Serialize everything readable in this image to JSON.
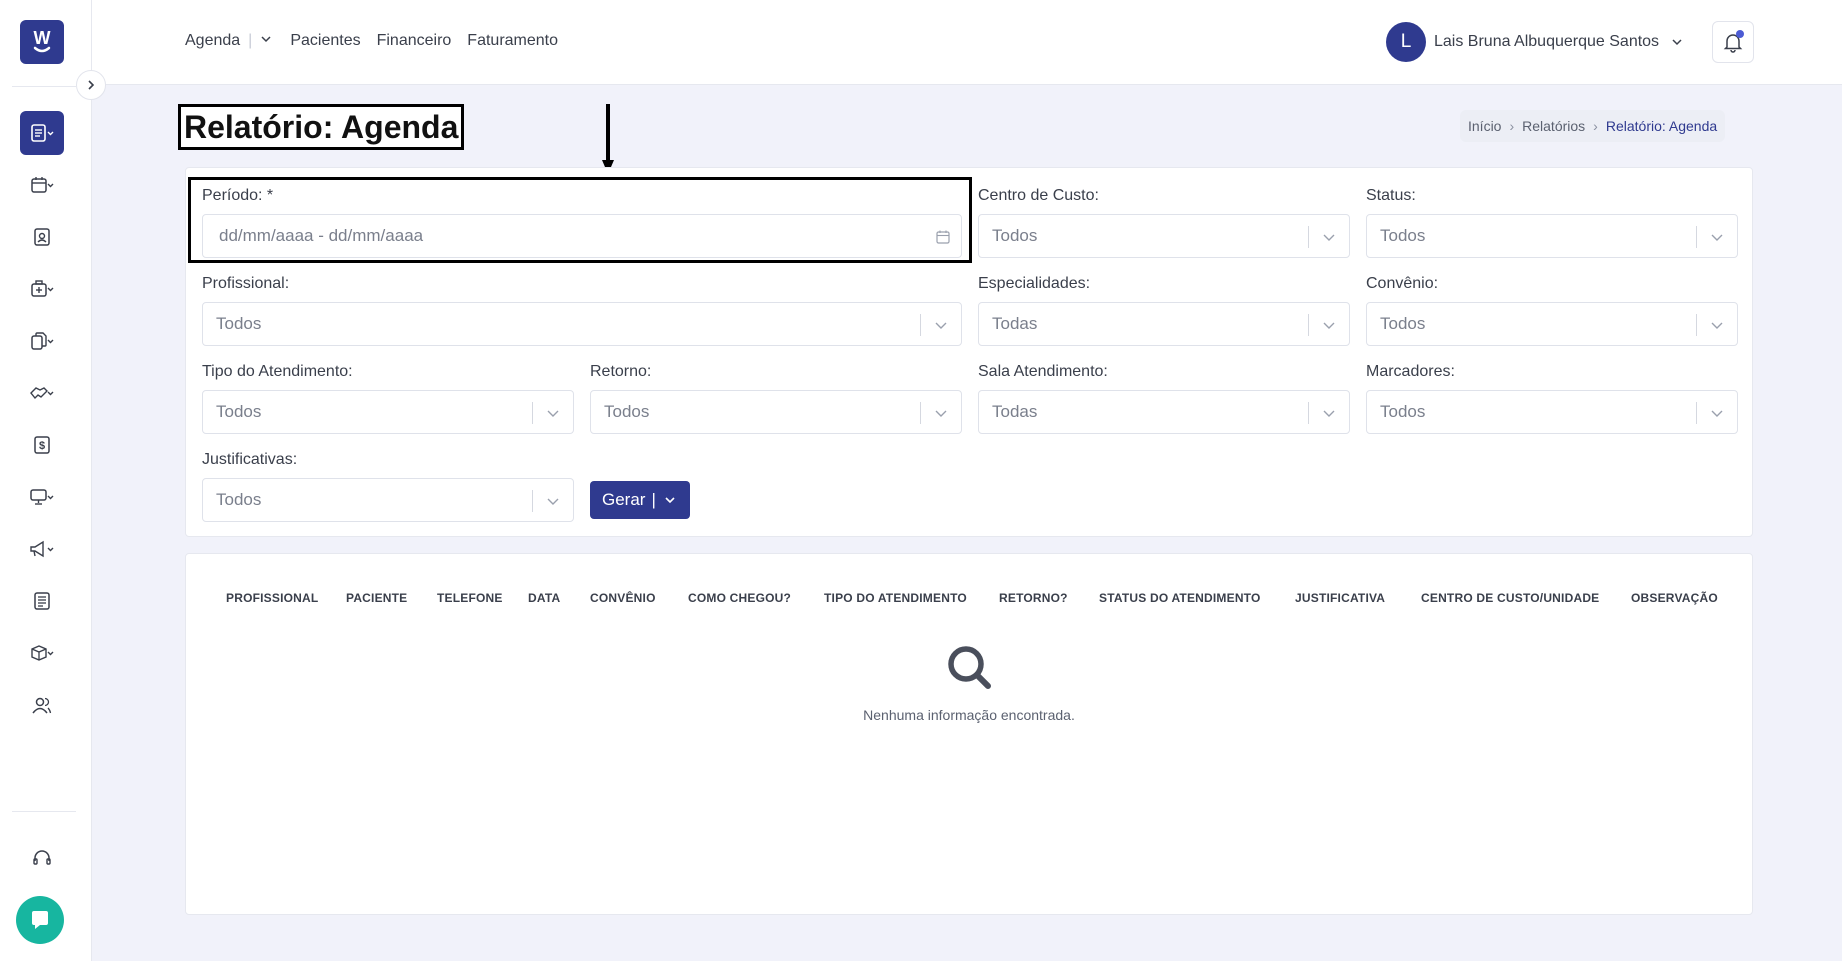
{
  "brand": {
    "logo_text": "W",
    "accent": "#2f3a8f",
    "chat_color": "#17b6a0"
  },
  "sidebar": {
    "items": [
      {
        "icon": "report-icon",
        "active": true,
        "dropdown": true
      },
      {
        "icon": "calendar-icon",
        "dropdown": true
      },
      {
        "icon": "patient-card-icon"
      },
      {
        "icon": "medical-case-icon",
        "dropdown": true
      },
      {
        "icon": "documents-icon",
        "dropdown": true
      },
      {
        "icon": "handshake-icon",
        "dropdown": true
      },
      {
        "icon": "dollar-icon"
      },
      {
        "icon": "monitor-icon",
        "dropdown": true
      },
      {
        "icon": "megaphone-icon",
        "dropdown": true
      },
      {
        "icon": "newspaper-icon"
      },
      {
        "icon": "box-icon",
        "dropdown": true
      },
      {
        "icon": "users-icon"
      },
      {
        "icon": "headset-icon"
      }
    ]
  },
  "topbar": {
    "nav": {
      "agenda": "Agenda",
      "pacientes": "Pacientes",
      "financeiro": "Financeiro",
      "faturamento": "Faturamento"
    },
    "user": {
      "initial": "L",
      "name": "Lais Bruna Albuquerque Santos"
    }
  },
  "page": {
    "title": "Relatório: Agenda",
    "breadcrumb": {
      "home": "Início",
      "reports": "Relatórios",
      "current": "Relatório: Agenda"
    }
  },
  "filters": {
    "periodo": {
      "label": "Período: *",
      "placeholder": "dd/mm/aaaa - dd/mm/aaaa"
    },
    "centro_custo": {
      "label": "Centro de Custo:",
      "value": "Todos"
    },
    "status": {
      "label": "Status:",
      "value": "Todos"
    },
    "profissional": {
      "label": "Profissional:",
      "value": "Todos"
    },
    "especialidades": {
      "label": "Especialidades:",
      "value": "Todas"
    },
    "convenio": {
      "label": "Convênio:",
      "value": "Todos"
    },
    "tipo_atendimento": {
      "label": "Tipo do Atendimento:",
      "value": "Todos"
    },
    "retorno": {
      "label": "Retorno:",
      "value": "Todos"
    },
    "sala_atendimento": {
      "label": "Sala Atendimento:",
      "value": "Todas"
    },
    "marcadores": {
      "label": "Marcadores:",
      "value": "Todos"
    },
    "justificativas": {
      "label": "Justificativas:",
      "value": "Todos"
    },
    "gerar_label": "Gerar",
    "gerar_bar": "|"
  },
  "table": {
    "columns": [
      "PROFISSIONAL",
      "PACIENTE",
      "TELEFONE",
      "DATA",
      "CONVÊNIO",
      "COMO CHEGOU?",
      "TIPO DO ATENDIMENTO",
      "RETORNO?",
      "STATUS DO ATENDIMENTO",
      "JUSTIFICATIVA",
      "CENTRO DE CUSTO/UNIDADE",
      "OBSERVAÇÃO"
    ],
    "empty_message": "Nenhuma informação encontrada."
  }
}
